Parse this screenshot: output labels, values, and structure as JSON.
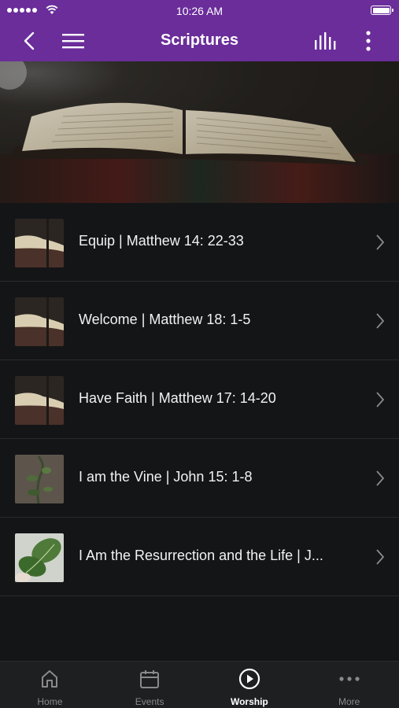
{
  "status_bar": {
    "time": "10:26 AM"
  },
  "header": {
    "title": "Scriptures"
  },
  "items": [
    {
      "label": "Equip | Matthew 14: 22-33",
      "thumb": "bible"
    },
    {
      "label": "Welcome | Matthew 18: 1-5",
      "thumb": "bible"
    },
    {
      "label": "Have Faith | Matthew 17: 14-20",
      "thumb": "bible"
    },
    {
      "label": "I am the Vine | John 15: 1-8",
      "thumb": "vine"
    },
    {
      "label": "I Am the Resurrection and the Life | J...",
      "thumb": "leaf"
    }
  ],
  "tabs": [
    {
      "label": "Home",
      "icon": "home-icon",
      "active": false
    },
    {
      "label": "Events",
      "icon": "calendar-icon",
      "active": false
    },
    {
      "label": "Worship",
      "icon": "play-circle-icon",
      "active": true
    },
    {
      "label": "More",
      "icon": "more-dots-icon",
      "active": false
    }
  ],
  "colors": {
    "header": "#6a2d9a",
    "background": "#141517",
    "tab_bar": "#1e1f21"
  }
}
